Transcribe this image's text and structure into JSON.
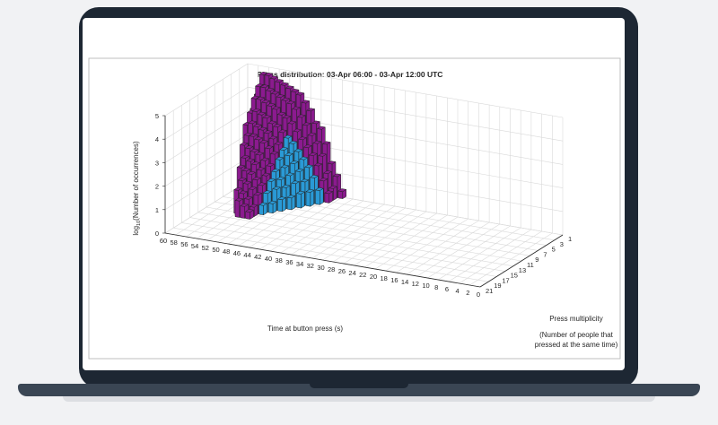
{
  "chart_data": {
    "type": "bar3d",
    "title": "Press distribution: 03-Apr 06:00 - 03-Apr 12:00 UTC",
    "zlabel_main": "log",
    "zlabel_sub": "10",
    "zlabel_rest": "(Number of occurrences)",
    "xlabel": "Time at button press (s)",
    "ylabel_line1": "Press multiplicity",
    "ylabel_line2": "(Number of people that",
    "ylabel_line3": "pressed at the same time)",
    "zlim": [
      0,
      5
    ],
    "zticks": [
      "0",
      "1",
      "2",
      "3",
      "4",
      "5"
    ],
    "xlim": [
      0,
      60
    ],
    "xticks": [
      "60",
      "58",
      "56",
      "54",
      "52",
      "50",
      "48",
      "46",
      "44",
      "42",
      "40",
      "38",
      "36",
      "34",
      "32",
      "30",
      "28",
      "26",
      "24",
      "22",
      "20",
      "18",
      "16",
      "14",
      "12",
      "10",
      "8",
      "6",
      "4",
      "2",
      "0"
    ],
    "ylim": [
      1,
      21
    ],
    "yticks": [
      "1",
      "3",
      "5",
      "7",
      "9",
      "11",
      "13",
      "15",
      "17",
      "19",
      "21"
    ],
    "grid": true,
    "colors": {
      "low": "#8b1a8f",
      "high": "#2a9ad6",
      "edge": "#222222",
      "grid": "#d9d9d9"
    },
    "series": [
      {
        "name": "",
        "multiplicity": 1,
        "x": [
          59,
          58,
          57,
          56,
          55,
          54,
          53,
          52,
          51,
          50,
          49,
          48,
          47,
          46,
          45,
          44,
          43,
          42
        ],
        "z": [
          0.4,
          3.8,
          4.7,
          4.7,
          4.6,
          4.5,
          4.4,
          4.3,
          4.2,
          4.1,
          3.8,
          3.5,
          3.0,
          2.8,
          2.2,
          1.4,
          0.9,
          0.3
        ]
      },
      {
        "name": "",
        "multiplicity": 2,
        "x": [
          58,
          57,
          56,
          55,
          54,
          53,
          52,
          51,
          50,
          49,
          48,
          47,
          46,
          45,
          44,
          43
        ],
        "z": [
          3.3,
          4.3,
          4.3,
          4.2,
          4.1,
          4.0,
          3.9,
          3.8,
          3.6,
          3.3,
          3.0,
          2.6,
          2.3,
          1.8,
          1.1,
          0.5
        ]
      },
      {
        "name": "",
        "multiplicity": 3,
        "x": [
          58,
          57,
          56,
          55,
          54,
          53,
          52,
          51,
          50,
          49,
          48,
          47,
          46,
          45,
          44,
          43
        ],
        "z": [
          2.8,
          3.9,
          3.9,
          3.8,
          3.7,
          3.6,
          3.4,
          3.3,
          3.1,
          2.8,
          2.5,
          2.2,
          1.9,
          1.5,
          0.9,
          0.4
        ]
      },
      {
        "name": "",
        "multiplicity": 4,
        "x": [
          57,
          56,
          55,
          54,
          53,
          52,
          51,
          50,
          49,
          48,
          47,
          46,
          45,
          44
        ],
        "z": [
          3.4,
          3.5,
          3.4,
          3.3,
          3.1,
          3.0,
          2.8,
          2.6,
          2.4,
          2.1,
          1.8,
          1.5,
          1.1,
          0.6
        ]
      },
      {
        "name": "",
        "multiplicity": 5,
        "x": [
          57,
          56,
          55,
          54,
          53,
          52,
          51,
          50,
          49,
          48,
          47,
          46,
          45
        ],
        "z": [
          3.0,
          3.1,
          3.0,
          2.9,
          2.8,
          2.6,
          2.4,
          2.2,
          2.0,
          1.7,
          1.4,
          1.0,
          0.6
        ]
      },
      {
        "name": "",
        "multiplicity": 6,
        "x": [
          56,
          55,
          54,
          53,
          52,
          51,
          50,
          49,
          48,
          47,
          46
        ],
        "z": [
          2.7,
          2.7,
          2.6,
          2.5,
          2.3,
          2.1,
          1.9,
          1.6,
          1.3,
          1.0,
          0.6
        ]
      },
      {
        "name": "",
        "multiplicity": 7,
        "x": [
          56,
          55,
          54,
          53,
          52,
          51,
          50,
          49,
          48,
          47
        ],
        "z": [
          2.4,
          2.3,
          2.2,
          2.1,
          1.9,
          1.7,
          1.5,
          1.2,
          0.9,
          0.5
        ]
      },
      {
        "name": "",
        "multiplicity": 8,
        "x": [
          55,
          54,
          53,
          52,
          51,
          50,
          49,
          48
        ],
        "z": [
          2.0,
          1.9,
          1.8,
          1.6,
          1.4,
          1.2,
          0.9,
          0.5
        ]
      },
      {
        "name": "",
        "multiplicity": 9,
        "x": [
          55,
          54,
          53,
          52,
          51,
          50,
          49
        ],
        "z": [
          1.7,
          1.6,
          1.5,
          1.3,
          1.1,
          0.8,
          0.4
        ]
      },
      {
        "name": "",
        "multiplicity": 10,
        "x": [
          54,
          53,
          52,
          51,
          50
        ],
        "z": [
          1.3,
          1.2,
          1.0,
          0.8,
          0.4
        ]
      },
      {
        "name": "",
        "multiplicity": 11,
        "x": [
          54,
          53,
          52,
          51
        ],
        "z": [
          1.0,
          0.9,
          0.7,
          0.4
        ]
      },
      {
        "name": "",
        "multiplicity": 12,
        "x": [
          53,
          52,
          51
        ],
        "z": [
          0.7,
          0.5,
          0.3
        ]
      }
    ]
  }
}
